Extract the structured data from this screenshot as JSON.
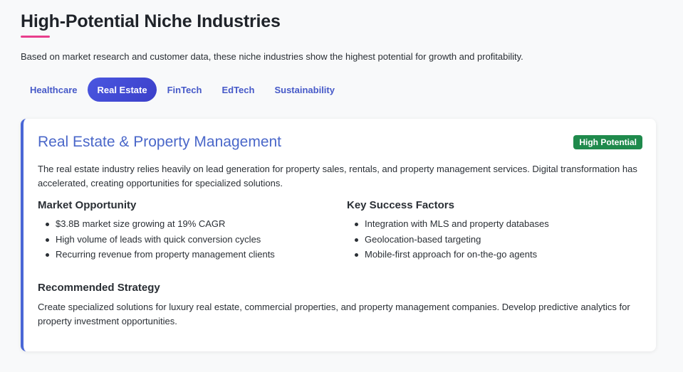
{
  "header": {
    "title": "High-Potential Niche Industries",
    "intro": "Based on market research and customer data, these niche industries show the highest potential for growth and profitability."
  },
  "tabs": [
    {
      "label": "Healthcare",
      "active": false
    },
    {
      "label": "Real Estate",
      "active": true
    },
    {
      "label": "FinTech",
      "active": false
    },
    {
      "label": "EdTech",
      "active": false
    },
    {
      "label": "Sustainability",
      "active": false
    }
  ],
  "card": {
    "title": "Real Estate & Property Management",
    "badge": "High Potential",
    "description": "The real estate industry relies heavily on lead generation for property sales, rentals, and property management services. Digital transformation has accelerated, creating opportunities for specialized solutions.",
    "market_opportunity": {
      "heading": "Market Opportunity",
      "items": [
        "$3.8B market size growing at 19% CAGR",
        "High volume of leads with quick conversion cycles",
        "Recurring revenue from property management clients"
      ]
    },
    "success_factors": {
      "heading": "Key Success Factors",
      "items": [
        "Integration with MLS and property databases",
        "Geolocation-based targeting",
        "Mobile-first approach for on-the-go agents"
      ]
    },
    "strategy": {
      "heading": "Recommended Strategy",
      "text": "Create specialized solutions for luxury real estate, commercial properties, and property management companies. Develop predictive analytics for property investment opportunities."
    }
  },
  "colors": {
    "accent": "#4a67c9",
    "tab_active": "#3b3fc9",
    "badge": "#1f8a4c",
    "underline": "#e83e8c"
  }
}
